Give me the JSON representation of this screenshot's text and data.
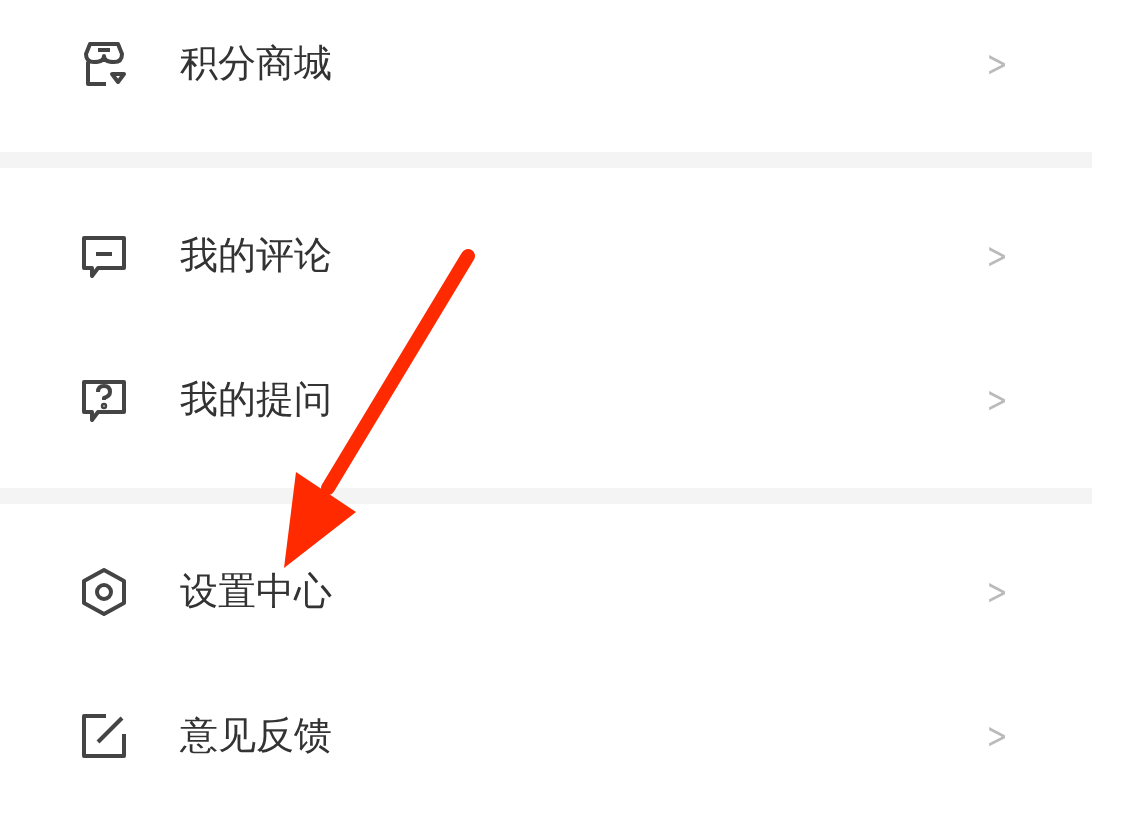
{
  "groups": [
    {
      "items": [
        {
          "kind": "shop",
          "label": "积分商城",
          "chevron": ">"
        }
      ]
    },
    {
      "items": [
        {
          "kind": "comment",
          "label": "我的评论",
          "chevron": ">"
        },
        {
          "kind": "question",
          "label": "我的提问",
          "chevron": ">"
        }
      ]
    },
    {
      "items": [
        {
          "kind": "settings",
          "label": "设置中心",
          "chevron": ">"
        },
        {
          "kind": "edit",
          "label": "意见反馈",
          "chevron": ">"
        }
      ]
    }
  ]
}
